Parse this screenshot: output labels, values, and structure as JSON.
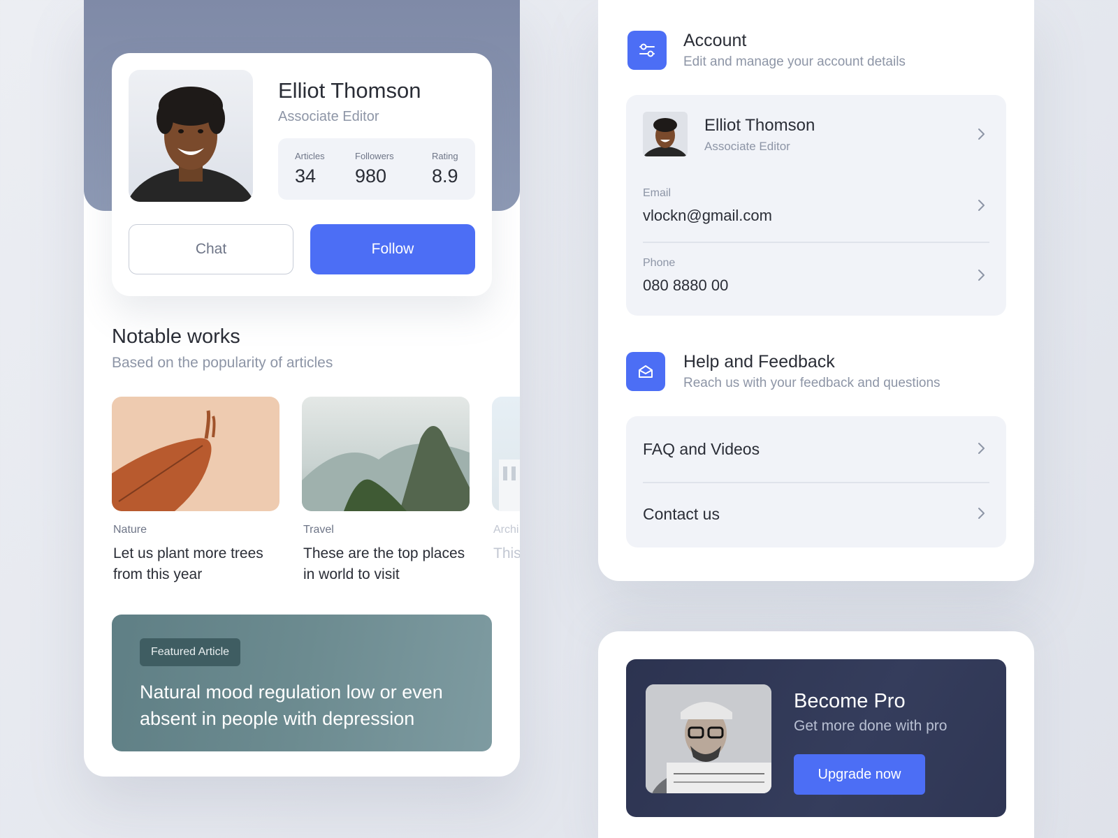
{
  "profile": {
    "name": "Elliot Thomson",
    "role": "Associate Editor",
    "stats": [
      {
        "label": "Articles",
        "value": "34"
      },
      {
        "label": "Followers",
        "value": "980"
      },
      {
        "label": "Rating",
        "value": "8.9"
      }
    ],
    "chat_label": "Chat",
    "follow_label": "Follow"
  },
  "notable": {
    "title": "Notable works",
    "subtitle": "Based on the popularity of articles",
    "works": [
      {
        "category": "Nature",
        "title": "Let us plant more trees from this year"
      },
      {
        "category": "Travel",
        "title": "These are the top places in world to visit"
      },
      {
        "category": "Archi",
        "title": "This mos"
      }
    ]
  },
  "featured": {
    "badge": "Featured Article",
    "title": "Natural mood regulation low or even absent in people with depression"
  },
  "account": {
    "title": "Account",
    "subtitle": "Edit and manage your account details",
    "user_name": "Elliot Thomson",
    "user_role": "Associate Editor",
    "email_label": "Email",
    "email_value": "vlockn@gmail.com",
    "phone_label": "Phone",
    "phone_value": "080 8880 00"
  },
  "help": {
    "title": "Help and Feedback",
    "subtitle": "Reach us with your feedback and questions",
    "items": [
      "FAQ and Videos",
      "Contact us"
    ]
  },
  "pro": {
    "title": "Become Pro",
    "subtitle": "Get more done with pro",
    "button": "Upgrade now"
  },
  "colors": {
    "accent": "#4c6ef5",
    "header_bg": "#8a96b0",
    "featured_bg": "#6c8b90",
    "pro_bg": "#2f3654"
  }
}
